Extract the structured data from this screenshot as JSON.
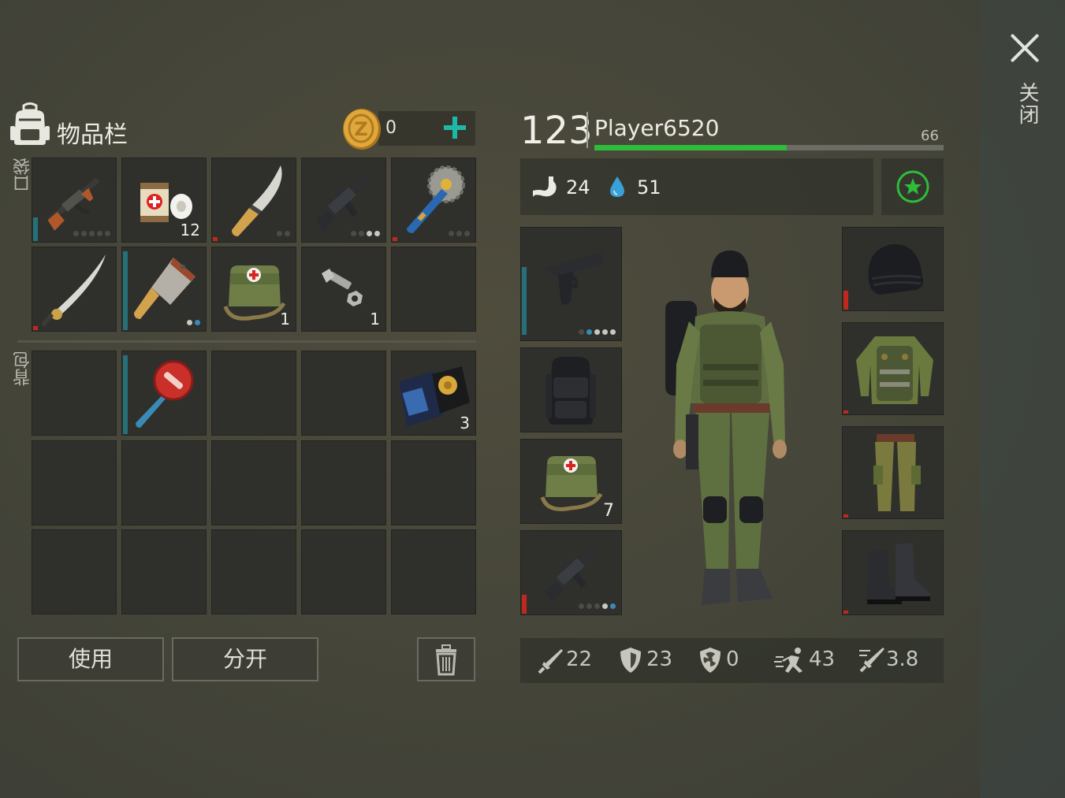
{
  "header": {
    "title": "物品栏",
    "coins": "0",
    "close_label": "关闭"
  },
  "sections": {
    "pockets": "口袋",
    "backpack": "背包"
  },
  "pocket_slots": [
    {
      "item": "ak47-rifle",
      "count": ""
    },
    {
      "item": "bandage",
      "count": "12"
    },
    {
      "item": "machete",
      "count": ""
    },
    {
      "item": "m16-rifle",
      "count": ""
    },
    {
      "item": "saw-blade-club",
      "count": ""
    },
    {
      "item": "katana",
      "count": ""
    },
    {
      "item": "cleaver",
      "count": ""
    },
    {
      "item": "first-aid-kit",
      "count": "1"
    },
    {
      "item": "bolt-and-nut",
      "count": "1"
    },
    {
      "item": "",
      "count": ""
    }
  ],
  "backpack_slots": [
    {
      "item": "",
      "count": ""
    },
    {
      "item": "stop-sign-axe",
      "count": ""
    },
    {
      "item": "",
      "count": ""
    },
    {
      "item": "",
      "count": ""
    },
    {
      "item": "police-badge-wallet",
      "count": "3"
    }
  ],
  "buttons": {
    "use": "使用",
    "split": "分开"
  },
  "player": {
    "level": "123",
    "name": "Player6520",
    "xp_value": "66",
    "xp_fraction": 0.55,
    "hunger": "24",
    "thirst": "51"
  },
  "equipment": {
    "left": [
      {
        "item": "pistol",
        "count": ""
      },
      {
        "item": "tactical-backpack",
        "count": ""
      },
      {
        "item": "first-aid-kit",
        "count": "7"
      },
      {
        "item": "m16-rifle",
        "count": ""
      }
    ],
    "right": [
      {
        "item": "beanie-hat"
      },
      {
        "item": "camo-armored-jacket"
      },
      {
        "item": "camo-pants"
      },
      {
        "item": "combat-boots"
      }
    ]
  },
  "bottom_stats": {
    "attack": "22",
    "defense": "23",
    "radiation": "0",
    "speed": "43",
    "attack_speed": "3.8"
  },
  "colors": {
    "accent_teal": "#1fb8a8",
    "xp_green": "#2ebc3a",
    "durability_teal": "#27707a",
    "durability_red": "#c0281e"
  }
}
